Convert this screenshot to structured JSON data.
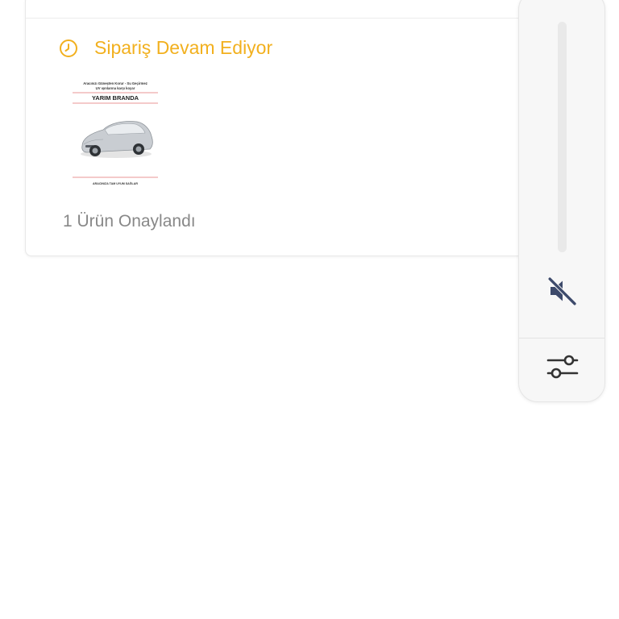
{
  "order": {
    "status_text": "Sipariş Devam Ediyor",
    "status_icon": "clock-icon",
    "status_color": "#f2b01e",
    "approved_text": "1 Ürün Onaylandı",
    "product_image": {
      "line1": "Aracınızı Güneşten Korur - Su Geçirmez",
      "line2": "UV ışınlarına karşı koyar",
      "title": "YARIM BRANDA",
      "footer": "ARACINIZA TAM UYUM SAĞLAR"
    }
  },
  "side_panel": {
    "mute_icon": "volume-mute-icon",
    "settings_icon": "sliders-icon",
    "icon_color": "#3d4a6b"
  }
}
